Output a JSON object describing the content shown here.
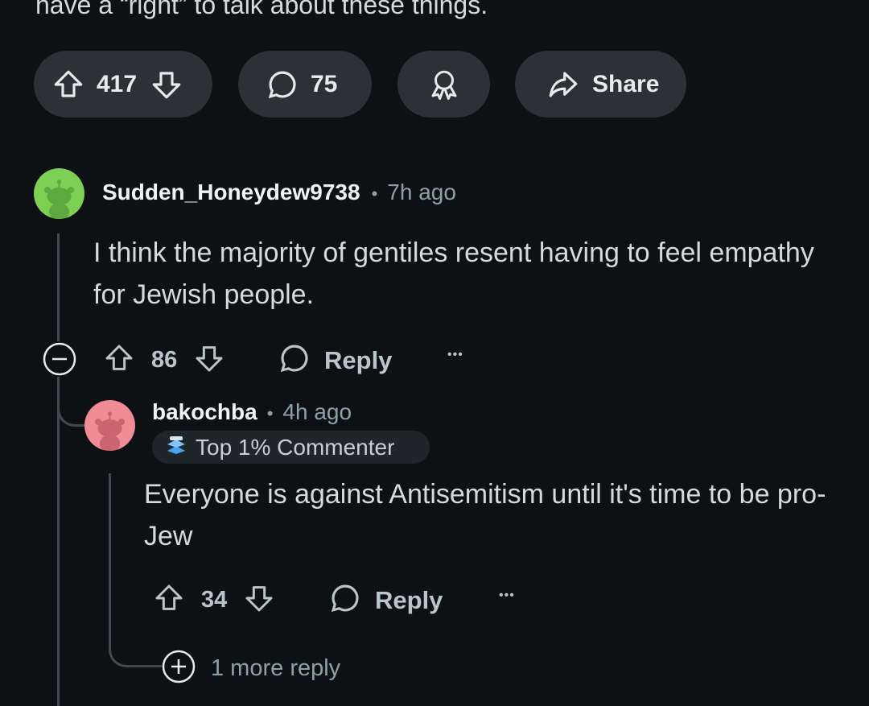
{
  "post": {
    "text_tail": "have a “right” to talk about these things.",
    "upvotes": "417",
    "comments": "75",
    "share_label": "Share"
  },
  "comment1": {
    "username": "Sudden_Honeydew9738",
    "separator": "•",
    "time": "7h ago",
    "body": "I think the majority of gentiles resent having to feel empathy for Jewish people.",
    "score": "86",
    "reply_label": "Reply",
    "more": "•••"
  },
  "comment2": {
    "username": "bakochba",
    "separator": "•",
    "time": "4h ago",
    "badge": "Top 1% Commenter",
    "body": "Everyone is against Antisemitism until it's time to be pro-Jew",
    "score": "34",
    "reply_label": "Reply",
    "more": "•••",
    "more_replies": "1 more reply"
  },
  "colors": {
    "background": "#0e1113",
    "pill": "#2a3236",
    "avatar1": "#7cd155",
    "avatar2": "#f08c95"
  }
}
